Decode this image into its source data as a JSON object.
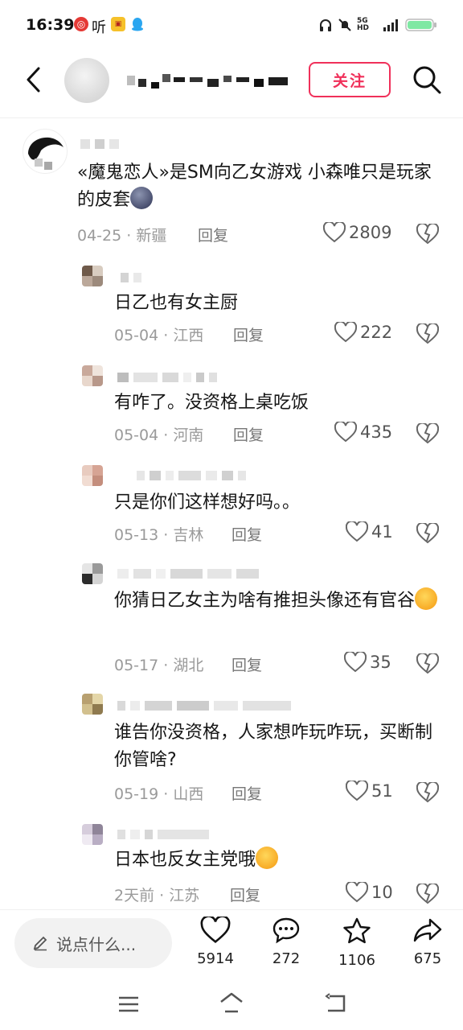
{
  "status_bar": {
    "time": "16:39",
    "app_icons": [
      "netease-music-icon",
      "ting-icon",
      "game-icon",
      "qq-icon"
    ],
    "ting_label": "听",
    "network_label": "5G HD",
    "system_icons": [
      "headphones-icon",
      "mute-icon",
      "signal-icon",
      "battery-icon"
    ]
  },
  "header": {
    "follow_label": "关注"
  },
  "comments": [
    {
      "text": "«魔鬼恋人»是SM向乙女游戏 小森唯只是玩家的皮套",
      "emoji": "new-moon-face-emoji",
      "date": "04-25",
      "location": "新疆",
      "reply_label": "回复",
      "likes": "2809"
    },
    {
      "text": "日乙也有女主厨",
      "date": "05-04",
      "location": "江西",
      "reply_label": "回复",
      "likes": "222"
    },
    {
      "text": "有咋了。没资格上桌吃饭",
      "date": "05-04",
      "location": "河南",
      "reply_label": "回复",
      "likes": "435"
    },
    {
      "text": "只是你们这样想好吗。。",
      "date": "05-13",
      "location": "吉林",
      "reply_label": "回复",
      "likes": "41"
    },
    {
      "text": "你猜日乙女主为啥有推担头像还有官谷",
      "emoji": "loudly-crying-laughing-emoji",
      "date": "05-17",
      "location": "湖北",
      "reply_label": "回复",
      "likes": "35"
    },
    {
      "text": "谁告你没资格，人家想咋玩咋玩，买断制你管啥?",
      "date": "05-19",
      "location": "山西",
      "reply_label": "回复",
      "likes": "51"
    },
    {
      "text": "日本也反女主党哦",
      "emoji": "loudly-crying-laughing-emoji",
      "date": "2天前",
      "location": "江苏",
      "reply_label": "回复",
      "likes": "10"
    }
  ],
  "bottom_bar": {
    "input_placeholder": "说点什么...",
    "likes": "5914",
    "comments": "272",
    "favorites": "1106",
    "shares": "675"
  },
  "colors": {
    "accent": "#f0305a",
    "meta_text": "#9a9a9a",
    "body_text": "#161616"
  }
}
